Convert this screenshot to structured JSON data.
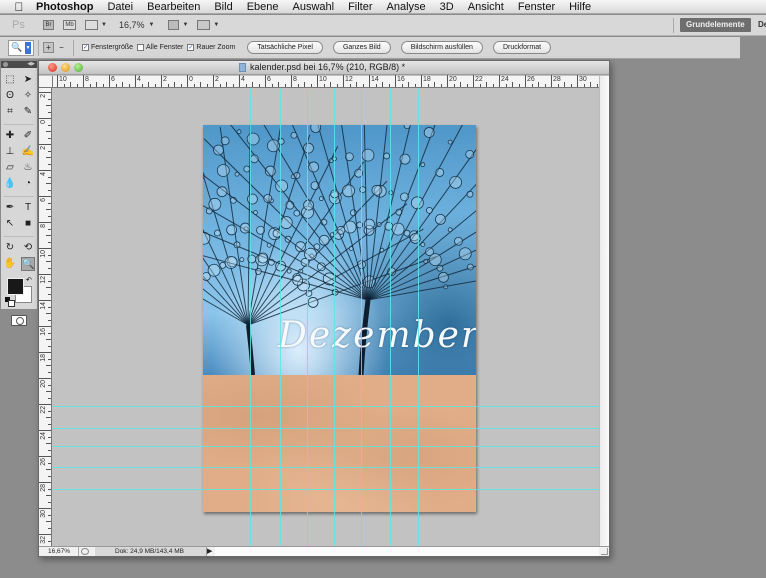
{
  "menubar": {
    "apple_icon": "apple-icon",
    "items": [
      "Photoshop",
      "Datei",
      "Bearbeiten",
      "Bild",
      "Ebene",
      "Auswahl",
      "Filter",
      "Analyse",
      "3D",
      "Ansicht",
      "Fenster",
      "Hilfe"
    ]
  },
  "appbar": {
    "logo": "Ps",
    "bridge_label": "Br",
    "minibridge_label": "Mb",
    "zoom_value": "16,7%",
    "workspace_active": "Grundelemente",
    "workspace_next": "De"
  },
  "options": {
    "tool_preset_icon": "zoom-tool-icon",
    "zoom_in_icon": "zoom-in-icon",
    "zoom_out_icon": "zoom-out-icon",
    "checkboxes": [
      {
        "label": "Fenstergröße",
        "checked": true
      },
      {
        "label": "Alle Fenster",
        "checked": false
      },
      {
        "label": "Rauer Zoom",
        "checked": true
      }
    ],
    "buttons": [
      "Tatsächliche Pixel",
      "Ganzes Bild",
      "Bildschirm ausfüllen",
      "Druckformat"
    ]
  },
  "tools": {
    "rows": [
      [
        "rectangular-marquee-icon",
        "move-icon"
      ],
      [
        "lasso-icon",
        "magic-wand-icon"
      ],
      [
        "crop-icon",
        "eyedropper-icon"
      ],
      [
        "healing-brush-icon",
        "brush-icon"
      ],
      [
        "clone-stamp-icon",
        "history-brush-icon"
      ],
      [
        "eraser-icon",
        "paint-bucket-icon"
      ],
      [
        "blur-icon",
        "dodge-icon"
      ],
      [
        "pen-icon",
        "type-icon"
      ],
      [
        "path-selection-icon",
        "rectangle-shape-icon"
      ],
      [
        "3d-rotate-icon",
        "3d-orbit-icon"
      ],
      [
        "hand-icon",
        "zoom-icon"
      ]
    ],
    "glyphs": [
      [
        "⬚",
        "➤"
      ],
      [
        "ʘ",
        "✧"
      ],
      [
        "⌗",
        "✎"
      ],
      [
        "✚",
        "✐"
      ],
      [
        "⊥",
        "✍"
      ],
      [
        "▱",
        "♨"
      ],
      [
        "💧",
        "◔"
      ],
      [
        "✒",
        "T"
      ],
      [
        "↖",
        "■"
      ],
      [
        "↻",
        "⟲"
      ],
      [
        "✋",
        "🔍"
      ]
    ],
    "active": "zoom-icon",
    "foreground_color": "#181818",
    "background_color": "#ffffff"
  },
  "document": {
    "title": "kalender.psd bei 16,7% (210, RGB/8) *",
    "ruler_h_labels": [
      "10",
      "8",
      "6",
      "4",
      "2",
      "0",
      "2",
      "4",
      "6",
      "8",
      "10",
      "12",
      "14",
      "16",
      "18",
      "20",
      "22",
      "24",
      "26",
      "28",
      "30"
    ],
    "ruler_v_labels": [
      "2",
      "0",
      "2",
      "4",
      "6",
      "8",
      "10",
      "12",
      "14",
      "16",
      "18",
      "20",
      "22",
      "24",
      "26",
      "28",
      "30",
      "32"
    ],
    "artwork_month": "Dezember",
    "guide_color": "#5ae6e6",
    "photo_tint": "#5aa8dc",
    "paper_color": "#e0ad88"
  },
  "status": {
    "zoom": "16,67%",
    "doc_info": "Dok: 24,9 MB/143,4 MB"
  }
}
